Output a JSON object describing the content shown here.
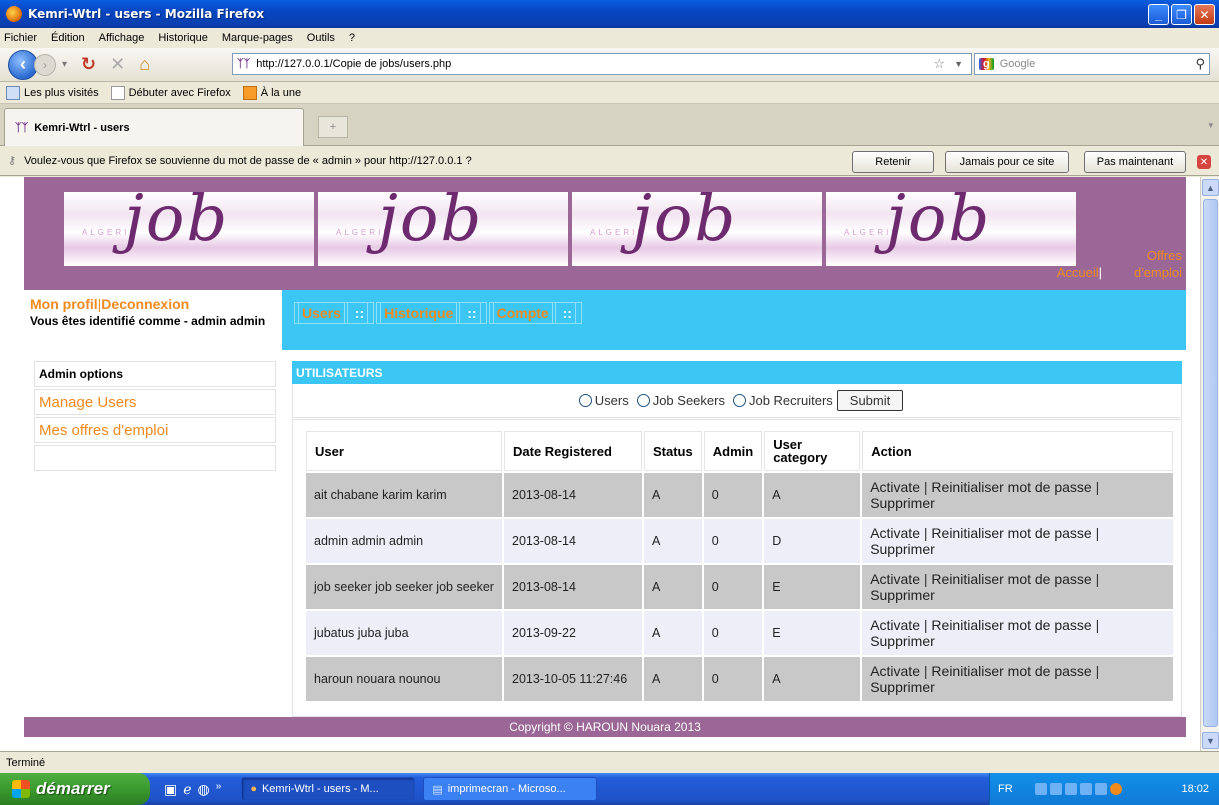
{
  "window": {
    "title": "Kemri-Wtrl - users - Mozilla Firefox"
  },
  "menubar": [
    "Fichier",
    "Édition",
    "Affichage",
    "Historique",
    "Marque-pages",
    "Outils",
    "?"
  ],
  "navbar": {
    "url": "http://127.0.0.1/Copie de jobs/users.php",
    "search_placeholder": "Google"
  },
  "bookmarks": [
    "Les plus visités",
    "Débuter avec Firefox",
    "À la une"
  ],
  "tab": {
    "label": "Kemri-Wtrl - users"
  },
  "notification": {
    "text": "Voulez-vous que Firefox se souvienne du mot de passe de « admin » pour http://127.0.0.1 ?",
    "remember": "Retenir",
    "never": "Jamais pour ce site",
    "not_now": "Pas maintenant"
  },
  "site": {
    "logo_word": "job",
    "logo_small": "ALGERIE",
    "topnav": {
      "home": "Accueil",
      "offers": "Offres d'emploi"
    },
    "user_links": {
      "profile": "Mon profil",
      "logout": "Deconnexion"
    },
    "identified": "Vous êtes identifié comme - admin admin",
    "menu": [
      "Users",
      "Historique",
      "Compte"
    ],
    "sidebar": {
      "header": "Admin options",
      "items": [
        "Manage Users",
        "Mes offres d'emploi"
      ]
    },
    "panel_title": "UTILISATEURS",
    "filters": [
      "Users",
      "Job Seekers",
      "Job Recruiters"
    ],
    "submit": "Submit",
    "columns": [
      "User",
      "Date Registered",
      "Status",
      "Admin",
      "User category",
      "Action"
    ],
    "actions": {
      "activate": "Activate",
      "reset": "Reinitialiser mot de passe",
      "delete": "Supprimer"
    },
    "rows": [
      {
        "user": "ait chabane karim karim",
        "date": "2013-08-14",
        "status": "A",
        "admin": "0",
        "category": "A"
      },
      {
        "user": "admin admin admin",
        "date": "2013-08-14",
        "status": "A",
        "admin": "0",
        "category": "D"
      },
      {
        "user": "job seeker job seeker job seeker",
        "date": "2013-08-14",
        "status": "A",
        "admin": "0",
        "category": "E"
      },
      {
        "user": "jubatus juba juba",
        "date": "2013-09-22",
        "status": "A",
        "admin": "0",
        "category": "E"
      },
      {
        "user": "haroun nouara nounou",
        "date": "2013-10-05 11:27:46",
        "status": "A",
        "admin": "0",
        "category": "A"
      }
    ],
    "footer": "Copyright © HAROUN Nouara 2013"
  },
  "statusbar": "Terminé",
  "taskbar": {
    "start": "démarrer",
    "tasks": [
      "Kemri-Wtrl - users - M...",
      "imprimecran - Microso..."
    ],
    "lang": "FR",
    "clock": "18:02"
  },
  "colors": {
    "accent_orange": "#f08a1c",
    "header_purple": "#9b6796",
    "menu_cyan": "#3cc6f4"
  }
}
